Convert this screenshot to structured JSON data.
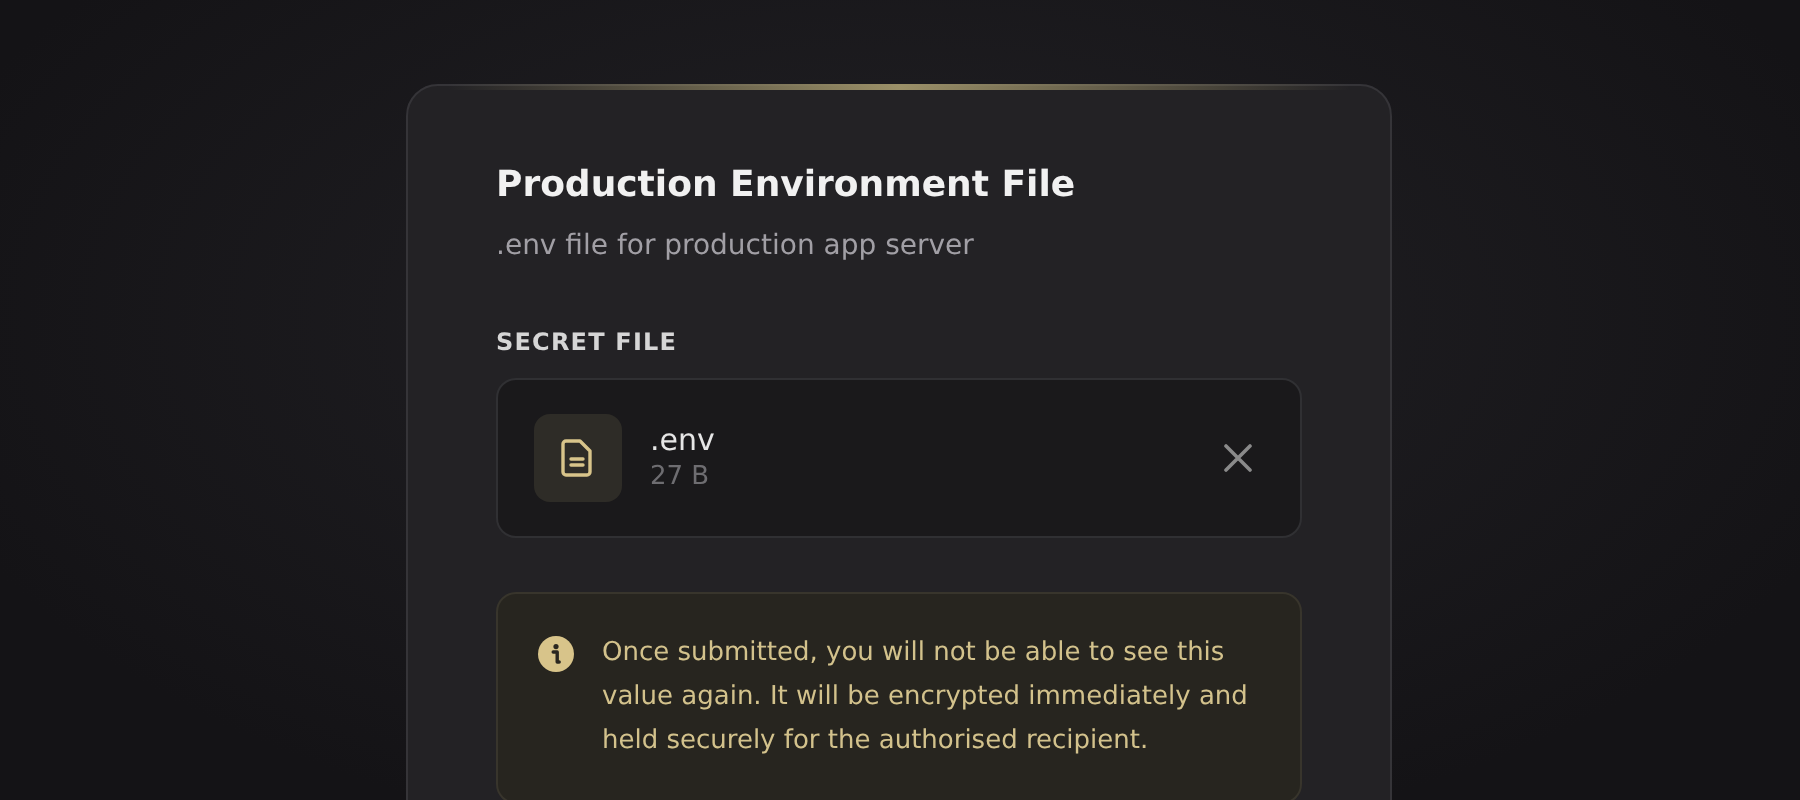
{
  "card": {
    "title": "Production Environment File",
    "subtitle": ".env file for production app server"
  },
  "file_section": {
    "label": "SECRET FILE",
    "file": {
      "name": ".env",
      "size": "27 B"
    }
  },
  "notice": {
    "text": "Once submitted, you will not be able to see this value again. It will be encrypted immediately and held securely for the authorised recipient."
  }
}
